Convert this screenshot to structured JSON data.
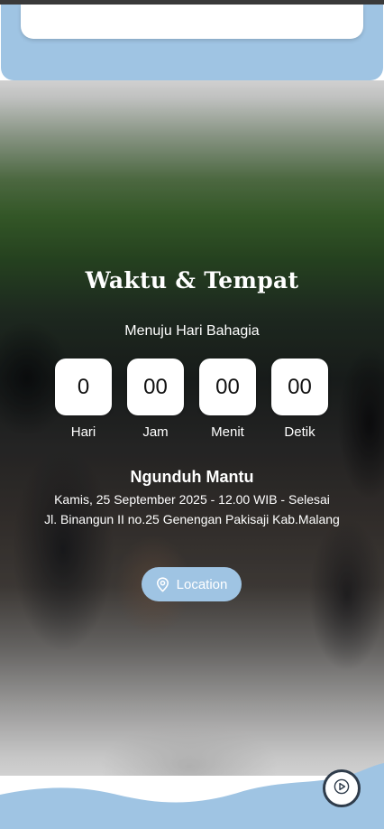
{
  "section": {
    "title": "Waktu & Tempat",
    "subtitle": "Menuju Hari Bahagia"
  },
  "countdown": [
    {
      "value": "0",
      "label": "Hari"
    },
    {
      "value": "00",
      "label": "Jam"
    },
    {
      "value": "00",
      "label": "Menit"
    },
    {
      "value": "00",
      "label": "Detik"
    }
  ],
  "event": {
    "name": "Ngunduh Mantu",
    "datetime": "Kamis, 25 September 2025 - 12.00 WIB - Selesai",
    "address": "Jl. Binangun II no.25 Genengan Pakisaji Kab.Malang"
  },
  "location_button": {
    "label": "Location",
    "icon": "map-pin-icon"
  },
  "music_button": {
    "icon": "play-icon"
  },
  "colors": {
    "accent": "#9fc4e3",
    "music_border": "#2f3c4b"
  }
}
